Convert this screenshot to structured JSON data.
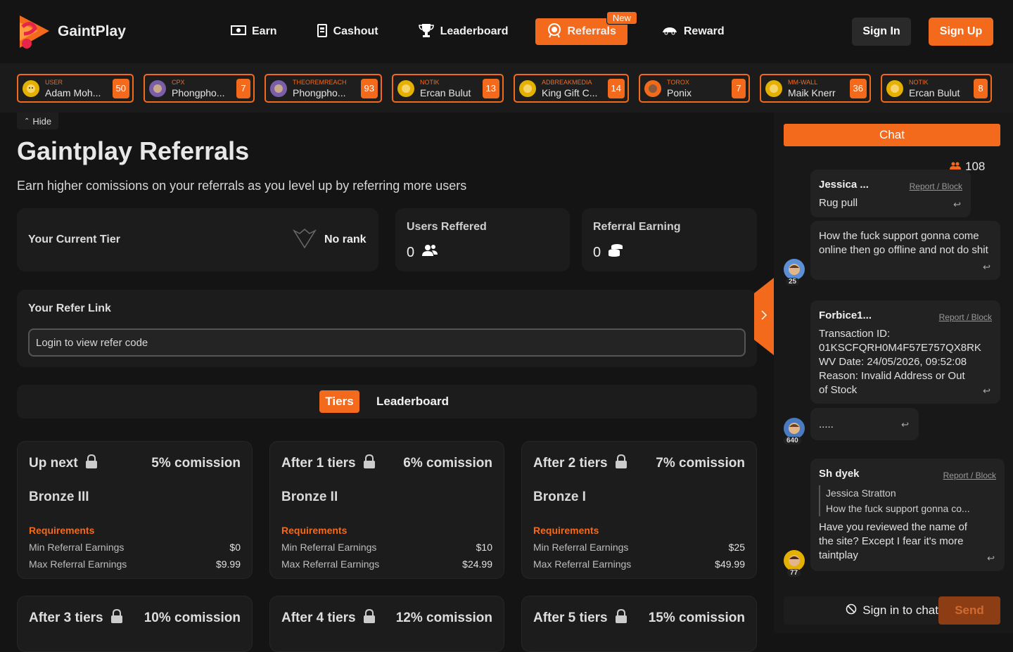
{
  "brand": {
    "name": "GaintPlay",
    "accent": "#f36a1d"
  },
  "nav": {
    "items": [
      {
        "label": "Earn",
        "icon": "cash-icon"
      },
      {
        "label": "Cashout",
        "icon": "wallet-icon"
      },
      {
        "label": "Leaderboard",
        "icon": "trophy-icon"
      },
      {
        "label": "Referrals",
        "icon": "badge-icon",
        "badge": "New",
        "active": true
      },
      {
        "label": "Reward",
        "icon": "car-icon"
      }
    ],
    "sign_in": "Sign In",
    "sign_up": "Sign Up"
  },
  "ticker": [
    {
      "source": "USER",
      "name": "Adam Moh...",
      "amount": "50"
    },
    {
      "source": "CPX",
      "name": "Phongpho...",
      "amount": "7"
    },
    {
      "source": "THEOREMREACH",
      "name": "Phongpho...",
      "amount": "93"
    },
    {
      "source": "NOTIK",
      "name": "Ercan Bulut",
      "amount": "13"
    },
    {
      "source": "ADBREAKMEDIA",
      "name": "King Gift C...",
      "amount": "14"
    },
    {
      "source": "TOROX",
      "name": "Ponix",
      "amount": "7"
    },
    {
      "source": "MM-WALL",
      "name": "Maik Knerr",
      "amount": "36"
    },
    {
      "source": "NOTIK",
      "name": "Ercan Bulut",
      "amount": "8"
    }
  ],
  "hide_label": "Hide",
  "page": {
    "title": "Gaintplay Referrals",
    "subtitle": "Earn higher comissions on your referrals as you level up by referring more users"
  },
  "tier_card": {
    "label": "Your Current Tier",
    "rank": "No rank"
  },
  "users_card": {
    "label": "Users Reffered",
    "value": "0"
  },
  "earning_card": {
    "label": "Referral Earning",
    "value": "0"
  },
  "refer_link": {
    "label": "Your Refer Link",
    "placeholder": "Login to view refer code"
  },
  "tabs": {
    "tiers": "Tiers",
    "leaderboard": "Leaderboard"
  },
  "tiers": [
    {
      "head": "Up next",
      "commission": "5% comission",
      "name": "Bronze III",
      "req_label": "Requirements",
      "min_label": "Min Referral Earnings",
      "min": "$0",
      "max_label": "Max Referral Earnings",
      "max": "$9.99"
    },
    {
      "head": "After 1 tiers",
      "commission": "6% comission",
      "name": "Bronze II",
      "req_label": "Requirements",
      "min_label": "Min Referral Earnings",
      "min": "$10",
      "max_label": "Max Referral Earnings",
      "max": "$24.99"
    },
    {
      "head": "After 2 tiers",
      "commission": "7% comission",
      "name": "Bronze I",
      "req_label": "Requirements",
      "min_label": "Min Referral Earnings",
      "min": "$25",
      "max_label": "Max Referral Earnings",
      "max": "$49.99"
    },
    {
      "head": "After 3 tiers",
      "commission": "10% comission"
    },
    {
      "head": "After 4 tiers",
      "commission": "12% comission"
    },
    {
      "head": "After 5 tiers",
      "commission": "15% comission"
    }
  ],
  "chat": {
    "button": "Chat",
    "online": "108",
    "report": "Report / Block",
    "messages": [
      {
        "user": "Jessica ...",
        "text": "Rug pull"
      },
      {
        "text": "How the fuck support gonna come online then go offline and not do shit",
        "level": "25"
      },
      {
        "user": "Forbice1...",
        "lines": [
          "Transaction ID:",
          "01KSCFQRH0M4F57E757QX8RK",
          "WV Date: 24/05/2026, 09:52:08",
          "Reason: Invalid Address or Out",
          "of Stock"
        ]
      },
      {
        "text": ".....",
        "level": "640"
      },
      {
        "user": "Sh dyek",
        "quote_user": "Jessica Stratton",
        "quote_text": "How the fuck support gonna co...",
        "lines": [
          "Have you reviewed the name of",
          "the site? Except I fear it's more",
          "taintplay"
        ],
        "level": "77"
      }
    ],
    "sign_in": "Sign in to chat",
    "send": "Send"
  }
}
